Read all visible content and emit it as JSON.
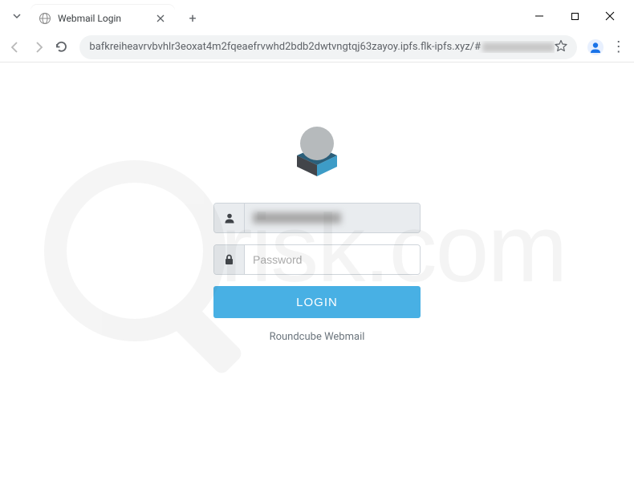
{
  "browser": {
    "tab_title": "Webmail Login",
    "url": "bafkreiheavrvbvhlr3eoxat4m2fqeaefrvwhd2bdb2dwtvngtqj63zayoy.ipfs.flk-ipfs.xyz/#"
  },
  "page": {
    "username_value": "",
    "password_placeholder": "Password",
    "login_button": "LOGIN",
    "footer": "Roundcube Webmail"
  },
  "watermark": "risk.com"
}
